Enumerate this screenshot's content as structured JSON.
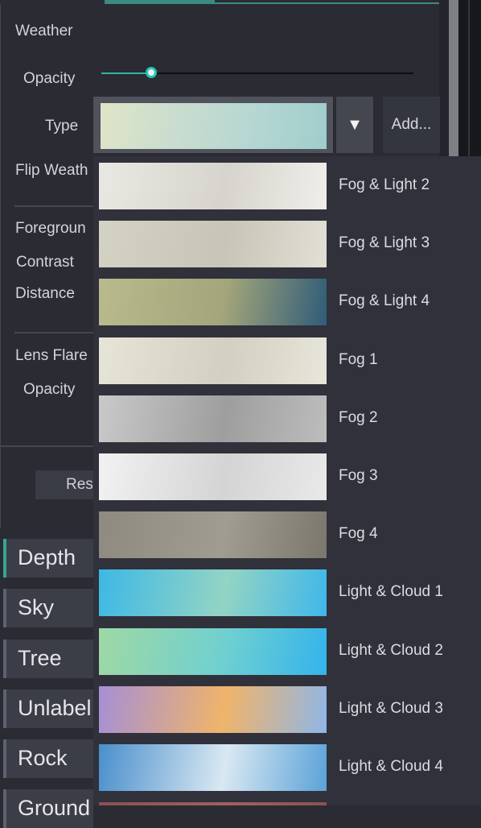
{
  "panel": {
    "section_title": "Weather",
    "opacity_label": "Opacity",
    "opacity_value": 0.16,
    "type_label": "Type",
    "dropdown_arrow": "▼",
    "add_label": "Add...",
    "flip_label": "Flip Weath",
    "foreground_label": "Foregroun",
    "contrast_label": "Contrast",
    "distance_label": "Distance",
    "lens_flare_label": "Lens Flare",
    "lens_opacity_label": "Opacity",
    "reset_label": "Res"
  },
  "categories": [
    {
      "label": "Depth"
    },
    {
      "label": "Sky"
    },
    {
      "label": "Tree"
    },
    {
      "label": "Unlabel"
    },
    {
      "label": "Rock"
    },
    {
      "label": "Ground"
    }
  ],
  "dropdown": {
    "items": [
      {
        "label": "Fog & Light 2",
        "colors": [
          "#e9e8e2",
          "#d6d4cc",
          "#efeee9"
        ]
      },
      {
        "label": "Fog & Light 3",
        "colors": [
          "#d4d2c4",
          "#c7c5b7",
          "#e2e0d5"
        ]
      },
      {
        "label": "Fog & Light 4",
        "colors": [
          "#b9bb8e",
          "#a3a57a",
          "#2f5c78"
        ]
      },
      {
        "label": "Fog 1",
        "colors": [
          "#e7e4d8",
          "#d3cfc1",
          "#e8e5da"
        ]
      },
      {
        "label": "Fog 2",
        "colors": [
          "#c9c9c9",
          "#9e9e9e",
          "#bdbdbd"
        ]
      },
      {
        "label": "Fog 3",
        "colors": [
          "#f2f2f2",
          "#d4d4d4",
          "#e9e9e9"
        ]
      },
      {
        "label": "Fog 4",
        "colors": [
          "#8f8a80",
          "#a09c92",
          "#7b776d"
        ]
      },
      {
        "label": "Light & Cloud 1",
        "colors": [
          "#3db8e6",
          "#93d4c4",
          "#3fb7ea"
        ]
      },
      {
        "label": "Light & Cloud 2",
        "colors": [
          "#9fd8a4",
          "#6fd0d0",
          "#34b3ec"
        ]
      },
      {
        "label": "Light & Cloud 3",
        "colors": [
          "#a58fd6",
          "#f0b46a",
          "#8fb6e8"
        ]
      },
      {
        "label": "Light & Cloud 4",
        "colors": [
          "#4a8fcc",
          "#d9e8f2",
          "#5aa2d8"
        ]
      },
      {
        "label": "",
        "colors": [
          "#8a5050",
          "#a06060",
          "#8a5050"
        ]
      }
    ]
  },
  "accent_color": "#2fb5a0"
}
